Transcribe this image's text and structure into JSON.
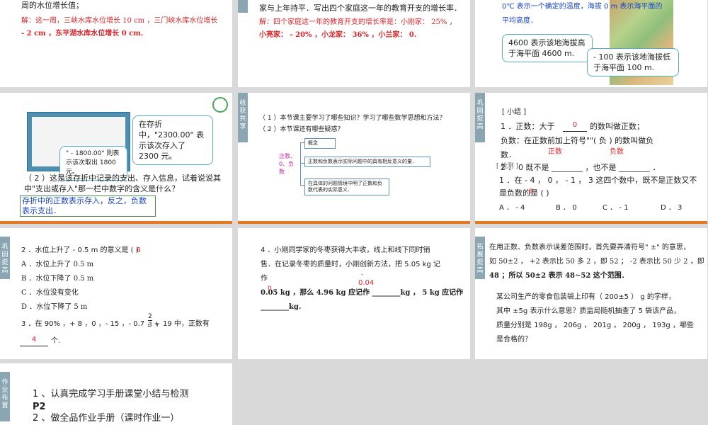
{
  "s1": {
    "line1": "周的水位增长值；",
    "line2": "解：这一周，三峡水库水位增长 10 cm ，三门峡水库水位增长",
    "line3": " - 2 cm ，东平湖水库水位增长 0 cm."
  },
  "s2": {
    "line1": "家与上年持平．写出四个家庭这一年的教育开支的增长率．",
    "line2": "解：四个家庭这一年的教育开支的增长率是：小刚家： 25% ，",
    "line3": "小亮家： - 20% ，小龙家： 36% ，小兰家： 0."
  },
  "s3": {
    "line1": "0℃ 表示一个确定的温度，海拔 0 m 表示海平面的",
    "line2": "平均高度．",
    "callout1": "4600 表示该地海拔高于海平面 4600 m.",
    "callout2": " - 100 表示该地海拔低于海平面 100 m."
  },
  "s4": {
    "callout1": "在存折中，\"2300.00\" 表示该次存入了 2300 元。",
    "callout2": "\" - 1800.00\" 则表示该次取出 1800 元。",
    "question": "（ 2 ）这是该存折中记录的支出、存入信息，试着说说其中\"支出或存入\"那一栏中数字的含义是什么？",
    "answer": "存折中的正数表示存入，反之，负数表示支出．"
  },
  "s5": {
    "tab": "收获共享",
    "q1": "（ 1 ）本节课主要学习了哪些知识？学习了哪些数学思想和方法？",
    "q2": "（ 2 ）本节课还有哪些疑惑？",
    "root": "正数、0、负数",
    "box1": "概念",
    "box2": "正数和负数表示实际问题中的具有相反意义的量．",
    "box3": "在具体的问题情境中明了正数和负数代表的实际意义．"
  },
  "s6": {
    "tab": "巩固提高",
    "title": "[ 小结 ]",
    "l1a": "1 ．正数：大于",
    "l1blank": "0",
    "l1b": "的数叫做正数；",
    "l2a": "负数：在正数前加上符号\"",
    "l2blank": "-",
    "l2b": "\"( 负 ) 的数叫做负",
    "l3": "数．",
    "ans1": "正数",
    "ans2": "负数",
    "l4a": "[ 检测 ]",
    "l4b": "2 ． 0 既不是 ________ ，也不是 ________ ．",
    "l5": "1 ．在 - 4 ， 0 ， - 1 ， 3 这四个数中，既不是正数又不",
    "l6": "是负数的是 (        )",
    "l6ans": "B",
    "opts": [
      "A ． - 4",
      "B ． 0",
      "C ． - 1",
      "D ． 3"
    ]
  },
  "s7": {
    "tab": "巩固提高",
    "q2": "2 ．水位上升了 - 0.5 m 的意义是 (        )",
    "q2ans": "B",
    "a": "A ．水位上升了 0.5 m",
    "b": "B ．水位下降了 0.5 m",
    "c": "C ．水位没有变化",
    "d": "D ．水位下降了 5 m",
    "q3": "3 ．在 90% ，+ 8 ，0 ，- 15 ，- 0.7 ，+",
    "frac_num": "2",
    "frac_den": "3",
    "q3b": "，19 中，正数有",
    "q3blank": "4",
    "q3c": "个."
  },
  "s8": {
    "tab": "巩固提高",
    "l1": "4 ．小刚同学家的冬枣获得大丰收，线上和线下同时销",
    "l2": "售．在记录冬枣的质量时，小刚创新方法，把 5.05 kg 记",
    "l3": "作",
    "l3ans": "-",
    "l3ans2": "0.04",
    "l4": "0.05 kg ，那么 4.96 kg 应记作 ________kg ， 5 kg 应记作",
    "l4ans": "0",
    "l5": "________kg."
  },
  "s9": {
    "tab": "拓展提高",
    "l1": "在用正数、负数表示误差范围时，首先要弄清符号\" ±\" 的意思，",
    "l2": "如 50±2 ， +2 表示比 50 多 2 ，即 52 ； -2 表示比 50 少 2 ，即",
    "l3": "48 ；所以 50±2 表示 48~52 这个范围．",
    "p1": "某公司生产的零食包装袋上印有（ 200±5 ） g 的字样，",
    "p2": "其中 ±5g 表示什么意思？质监局随机抽查了 5 袋该产品，",
    "p3": "质量分别是 198g ， 206g ， 201g ， 200g ， 193g ，哪些",
    "p4": "是合格的？"
  },
  "s10": {
    "tab": "作业布置",
    "l1": "1 、认真完成学习手册课堂小结与检测",
    "l2": "P2",
    "l3": "2 、做全品作业手册（课时作业一）"
  }
}
